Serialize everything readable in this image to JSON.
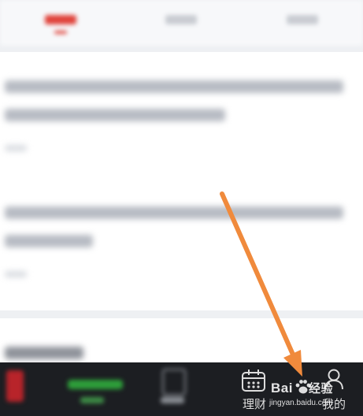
{
  "bottom_nav": {
    "items": [
      {
        "label": "",
        "icon": "home-icon"
      },
      {
        "label": "",
        "icon": "market-icon"
      },
      {
        "label": "",
        "icon": "trade-icon"
      },
      {
        "label": "理财",
        "icon": "calendar-icon"
      },
      {
        "label": "我的",
        "icon": "user-icon"
      }
    ]
  },
  "watermark": {
    "brand_prefix": "Bai",
    "brand_suffix": "经验",
    "url": "jingyan.baidu.com"
  },
  "colors": {
    "accent_red": "#e0433b",
    "nav_background": "#1c1e22",
    "arrow": "#f08a3c"
  }
}
